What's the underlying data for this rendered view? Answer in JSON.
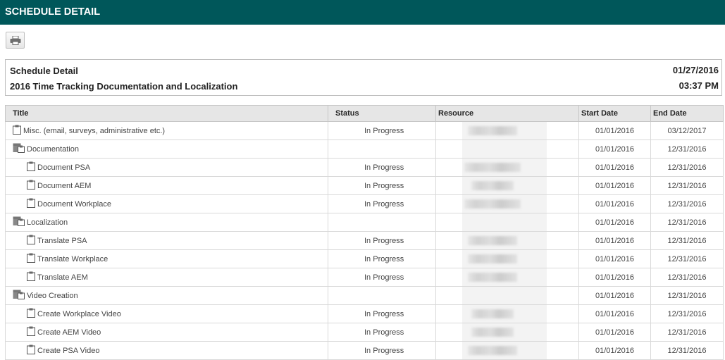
{
  "window": {
    "title": "SCHEDULE DETAIL"
  },
  "toolbar": {
    "print_icon": "printer-icon"
  },
  "header": {
    "title": "Schedule Detail",
    "subtitle": "2016 Time Tracking Documentation and Localization",
    "date": "01/27/2016",
    "time": "03:37 PM"
  },
  "table": {
    "columns": [
      "Title",
      "Status",
      "Resource",
      "Start Date",
      "End Date"
    ],
    "rows": [
      {
        "title": "Misc. (email, surveys, administrative etc.)",
        "type": "task",
        "status": "In Progress",
        "start": "01/01/2016",
        "end": "03/12/2017",
        "blur": 70
      },
      {
        "title": "Documentation",
        "type": "group",
        "status": "",
        "start": "01/01/2016",
        "end": "12/31/2016",
        "blur": 0
      },
      {
        "title": "Document PSA",
        "type": "child",
        "status": "In Progress",
        "start": "01/01/2016",
        "end": "12/31/2016",
        "blur": 80
      },
      {
        "title": "Document AEM",
        "type": "child",
        "status": "In Progress",
        "start": "01/01/2016",
        "end": "12/31/2016",
        "blur": 60
      },
      {
        "title": "Document Workplace",
        "type": "child",
        "status": "In Progress",
        "start": "01/01/2016",
        "end": "12/31/2016",
        "blur": 80
      },
      {
        "title": "Localization",
        "type": "group",
        "status": "",
        "start": "01/01/2016",
        "end": "12/31/2016",
        "blur": 0
      },
      {
        "title": "Translate PSA",
        "type": "child",
        "status": "In Progress",
        "start": "01/01/2016",
        "end": "12/31/2016",
        "blur": 70
      },
      {
        "title": "Translate Workplace",
        "type": "child",
        "status": "In Progress",
        "start": "01/01/2016",
        "end": "12/31/2016",
        "blur": 70
      },
      {
        "title": "Translate AEM",
        "type": "child",
        "status": "In Progress",
        "start": "01/01/2016",
        "end": "12/31/2016",
        "blur": 70
      },
      {
        "title": "Video Creation",
        "type": "group",
        "status": "",
        "start": "01/01/2016",
        "end": "12/31/2016",
        "blur": 0
      },
      {
        "title": "Create Workplace Video",
        "type": "child",
        "status": "In Progress",
        "start": "01/01/2016",
        "end": "12/31/2016",
        "blur": 60
      },
      {
        "title": "Create AEM Video",
        "type": "child",
        "status": "In Progress",
        "start": "01/01/2016",
        "end": "12/31/2016",
        "blur": 60
      },
      {
        "title": "Create PSA Video",
        "type": "child",
        "status": "In Progress",
        "start": "01/01/2016",
        "end": "12/31/2016",
        "blur": 70
      }
    ]
  }
}
